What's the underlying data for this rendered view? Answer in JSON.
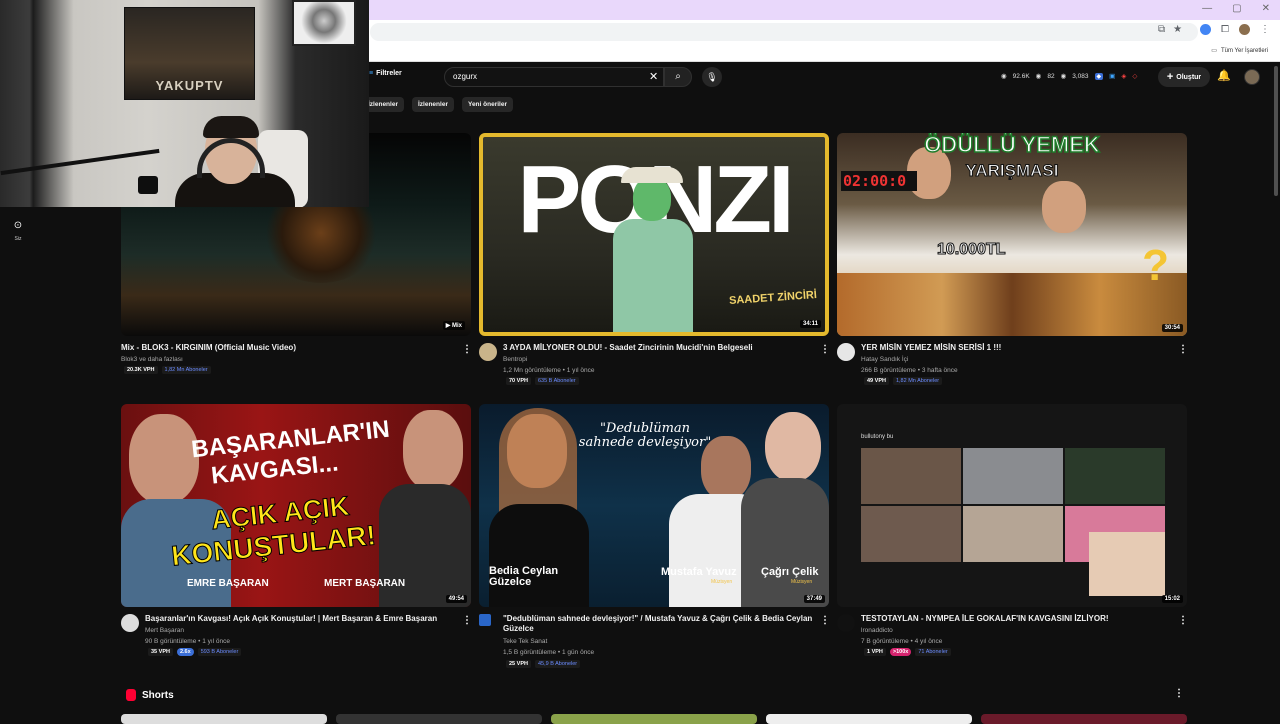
{
  "browser": {
    "bookmarks_all": "Tüm Yer İşaretleri"
  },
  "webcam": {
    "poster_text": "YAKUPTV"
  },
  "youtube": {
    "filters_label": "Filtreler",
    "search_value": "ozgurx",
    "stats": {
      "views": "92.6K",
      "likes": "82",
      "count": "3,083"
    },
    "create_label": "Oluştur",
    "guide_you_label": "Siz",
    "chips": [
      "İzlenenler",
      "İzlenenler",
      "Yeni öneriler"
    ]
  },
  "videos": [
    {
      "title": "Mix - BLOK3 - KIRGINIM (Official Music Video)",
      "channel": "Blok3 ve daha fazlası",
      "meta": "",
      "vph": "20.3K VPH",
      "subs": "1,82 Mn Aboneler",
      "badge": "",
      "duration": "",
      "mix_label": "Mix"
    },
    {
      "title": "3 AYDA MİLYONER OLDU! - Saadet Zincirinin Mucidi'nin Belgeseli",
      "channel": "Bentropi",
      "meta": "1,2 Mn görüntüleme • 1 yıl önce",
      "vph": "70 VPH",
      "subs": "635 B Aboneler",
      "badge": "",
      "duration": "34:11",
      "thumb_title": "PONZI",
      "thumb_sub": "SAADET ZİNCİRİ"
    },
    {
      "title": "YER MİSİN YEMEZ MİSİN SERİSİ 1 !!!",
      "channel": "Hatay Sandık İçi",
      "meta": "266 B görüntüleme • 3 hafta önce",
      "vph": "49 VPH",
      "subs": "1,82 Mn Aboneler",
      "badge": "",
      "duration": "30:54",
      "thumb_title": "ÖDÜLLÜ YEMEK",
      "thumb_title2": "YARIŞMASI",
      "thumb_timer": "02:00:0",
      "thumb_prize": "10.000TL",
      "thumb_q": "?"
    },
    {
      "title": "Başaranlar'ın Kavgası! Açık Açık Konuştular! | Mert Başaran & Emre Başaran",
      "channel": "Mert Başaran",
      "meta": "90 B görüntüleme • 1 yıl önce",
      "vph": "35 VPH",
      "subs": "593 B Aboneler",
      "badge": "2.6x",
      "duration": "49:54",
      "thumb_l1": "BAŞARANLAR'IN",
      "thumb_l2": "KAVGASI...",
      "thumb_l3": "AÇIK AÇIK",
      "thumb_l4": "KONUŞTULAR!",
      "thumb_n1": "EMRE BAŞARAN",
      "thumb_n2": "MERT BAŞARAN"
    },
    {
      "title": "\"Dedublüman sahnede devleşiyor!\" / Mustafa Yavuz & Çağrı Çelik & Bedia Ceylan Güzelce",
      "channel": "Teke Tek Sanat",
      "meta": "1,5 B görüntüleme • 1 gün önce",
      "vph": "25 VPH",
      "subs": "45,9 B Aboneler",
      "badge": "",
      "duration": "37:49",
      "thumb_title": "\"Dedublüman sahnede devleşiyor\"",
      "thumb_n1a": "Bedia Ceylan",
      "thumb_n1b": "Güzelce",
      "thumb_n2": "Mustafa Yavuz",
      "thumb_n3": "Çağrı Çelik",
      "thumb_role": "Müzisyen"
    },
    {
      "title": "TESTOTAYLAN - NYMPEA İLE GOKALAF'IN KAVGASINI İZLİYOR!",
      "channel": "lronaddicto",
      "meta": "7 B görüntüleme • 4 yıl önce",
      "vph": "1 VPH",
      "subs": "71 Aboneler",
      "badge": ">100x",
      "duration": "15:02",
      "thumb_chat": "bullutony bu"
    }
  ],
  "shorts": {
    "label": "Shorts"
  },
  "colors": {
    "accent": "#ff0033",
    "ponzi_border": "#e4b92d",
    "vph_blue": "#3b6fd8",
    "badge_pink": "#d6246f"
  }
}
